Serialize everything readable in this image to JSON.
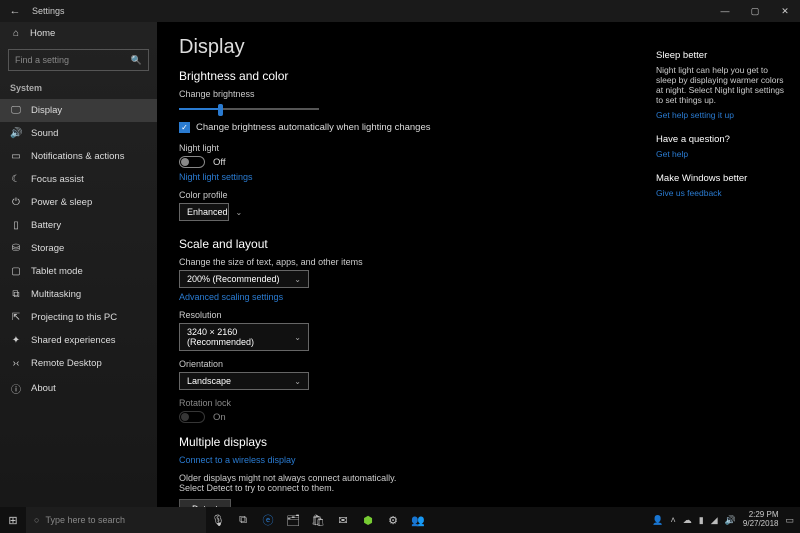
{
  "titlebar": {
    "title": "Settings"
  },
  "sidebar": {
    "home": "Home",
    "search_placeholder": "Find a setting",
    "section": "System",
    "items": [
      {
        "label": "Display",
        "icon": "🖵"
      },
      {
        "label": "Sound",
        "icon": "🔊"
      },
      {
        "label": "Notifications & actions",
        "icon": "▭"
      },
      {
        "label": "Focus assist",
        "icon": "☾"
      },
      {
        "label": "Power & sleep",
        "icon": "⏻"
      },
      {
        "label": "Battery",
        "icon": "▯"
      },
      {
        "label": "Storage",
        "icon": "⛁"
      },
      {
        "label": "Tablet mode",
        "icon": "▢"
      },
      {
        "label": "Multitasking",
        "icon": "⧉"
      },
      {
        "label": "Projecting to this PC",
        "icon": "⇱"
      },
      {
        "label": "Shared experiences",
        "icon": "✦"
      },
      {
        "label": "Remote Desktop",
        "icon": "›‹"
      },
      {
        "label": "About",
        "icon": "ⓘ"
      }
    ]
  },
  "page": {
    "title": "Display",
    "brightness_section": "Brightness and color",
    "brightness_label": "Change brightness",
    "autobright_label": "Change brightness automatically when lighting changes",
    "nightlight_label": "Night light",
    "off": "Off",
    "on": "On",
    "nightlight_link": "Night light settings",
    "colorprofile_label": "Color profile",
    "colorprofile_value": "Enhanced",
    "scale_section": "Scale and layout",
    "scale_label": "Change the size of text, apps, and other items",
    "scale_value": "200% (Recommended)",
    "advanced_scaling": "Advanced scaling settings",
    "resolution_label": "Resolution",
    "resolution_value": "3240 × 2160 (Recommended)",
    "orientation_label": "Orientation",
    "orientation_value": "Landscape",
    "rotation_label": "Rotation lock",
    "multiple_section": "Multiple displays",
    "wireless_link": "Connect to a wireless display",
    "older_text": "Older displays might not always connect automatically. Select Detect to try to connect to them.",
    "detect": "Detect"
  },
  "right": {
    "sleep_h": "Sleep better",
    "sleep_body": "Night light can help you get to sleep by displaying warmer colors at night. Select Night light settings to set things up.",
    "sleep_link": "Get help setting it up",
    "question_h": "Have a question?",
    "question_link": "Get help",
    "better_h": "Make Windows better",
    "better_link": "Give us feedback"
  },
  "taskbar": {
    "search": "Type here to search",
    "time": "2:29 PM",
    "date": "9/27/2018"
  }
}
